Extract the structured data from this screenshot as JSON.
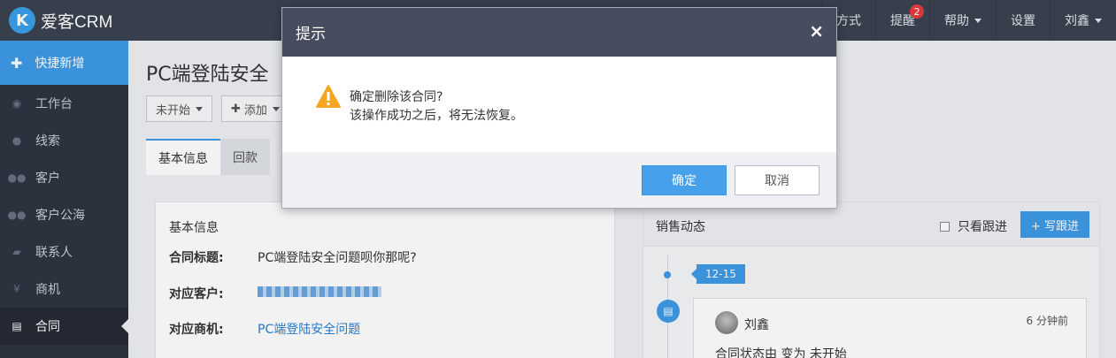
{
  "brand": {
    "logo_letter": "K",
    "name": "爱客CRM"
  },
  "topnav": {
    "items": [
      {
        "label": "方式"
      },
      {
        "label": "提醒",
        "badge": "2"
      },
      {
        "label": "帮助"
      },
      {
        "label": "设置"
      },
      {
        "label": "刘鑫"
      }
    ]
  },
  "sidebar": {
    "quick_add": "快捷新增",
    "items": [
      {
        "label": "工作台",
        "icon": "dashboard-icon"
      },
      {
        "label": "线索",
        "icon": "globe-icon"
      },
      {
        "label": "客户",
        "icon": "users-icon"
      },
      {
        "label": "客户公海",
        "icon": "users-icon"
      },
      {
        "label": "联系人",
        "icon": "chat-icon"
      },
      {
        "label": "商机",
        "icon": "yen-icon"
      },
      {
        "label": "合同",
        "icon": "document-icon",
        "active": true
      }
    ]
  },
  "main": {
    "title": "PC端登陆安全",
    "toolbar": {
      "status_label": "未开始",
      "add_label": "添加"
    },
    "tabs": [
      {
        "label": "基本信息",
        "active": true
      },
      {
        "label": "回款"
      }
    ],
    "info": {
      "title": "基本信息",
      "rows": [
        {
          "label": "合同标题:",
          "value": "PC端登陆安全问题呗你那呢?"
        },
        {
          "label": "对应客户:",
          "value": ""
        },
        {
          "label": "对应商机:",
          "value": "PC端登陆安全问题"
        }
      ]
    },
    "activity": {
      "title": "销售动态",
      "filter_label": "只看跟进",
      "write_label": "+ 写跟进",
      "date": "12-15",
      "user": "刘鑫",
      "time": "6 分钟前",
      "text": "合同状态由 变为 未开始"
    }
  },
  "modal": {
    "title": "提示",
    "close": "×",
    "line1": "确定删除该合同?",
    "line2": "该操作成功之后，将无法恢复。",
    "ok": "确定",
    "cancel": "取消"
  },
  "colors": {
    "accent": "#3e9ae6",
    "topbar": "#3c4351",
    "sidebar": "#2f3541",
    "modal_header": "#474d5e",
    "warning": "#f5a623"
  }
}
